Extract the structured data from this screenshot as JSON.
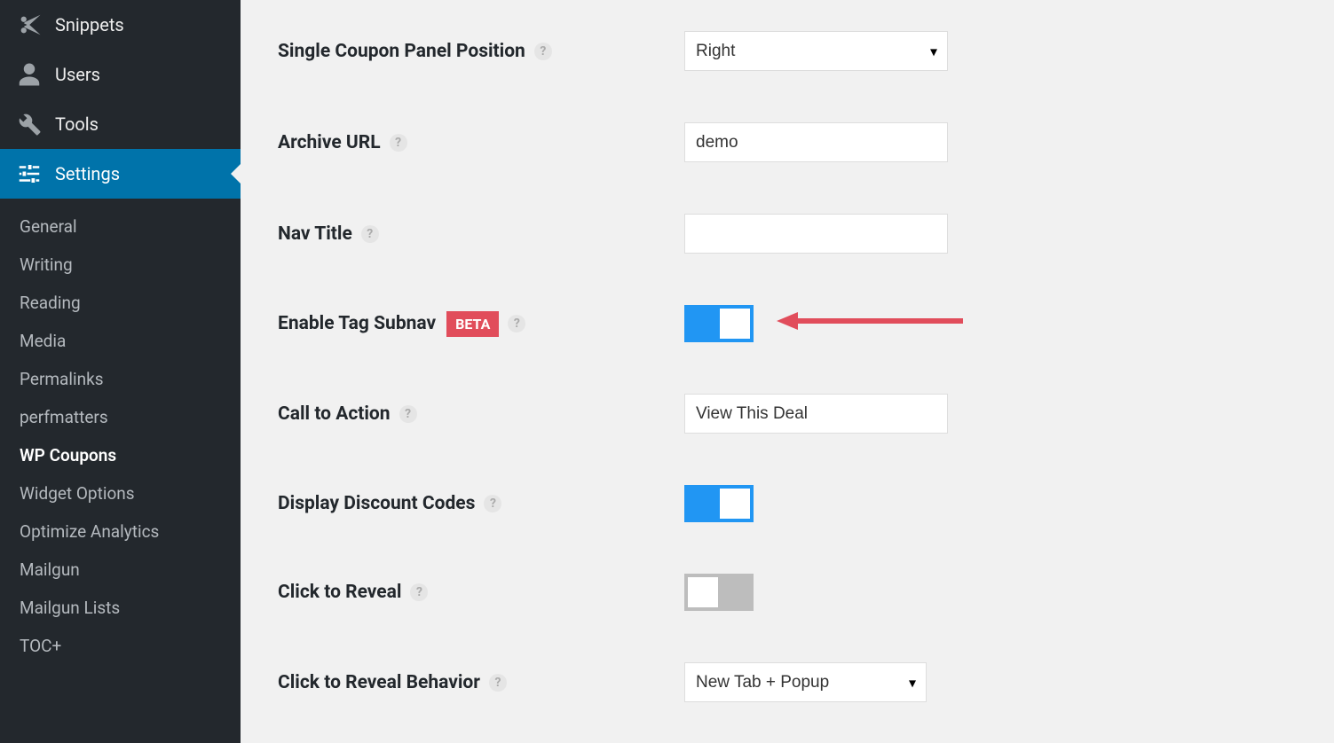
{
  "sidebar": {
    "nav": [
      {
        "label": "Snippets",
        "icon": "scissors"
      },
      {
        "label": "Users",
        "icon": "user"
      },
      {
        "label": "Tools",
        "icon": "wrench"
      },
      {
        "label": "Settings",
        "icon": "sliders",
        "active": true
      }
    ],
    "sub": [
      {
        "label": "General"
      },
      {
        "label": "Writing"
      },
      {
        "label": "Reading"
      },
      {
        "label": "Media"
      },
      {
        "label": "Permalinks"
      },
      {
        "label": "perfmatters"
      },
      {
        "label": "WP Coupons",
        "current": true
      },
      {
        "label": "Widget Options"
      },
      {
        "label": "Optimize Analytics"
      },
      {
        "label": "Mailgun"
      },
      {
        "label": "Mailgun Lists"
      },
      {
        "label": "TOC+"
      }
    ]
  },
  "form": {
    "coupon_panel_position": {
      "label": "Single Coupon Panel Position",
      "value": "Right"
    },
    "archive_url": {
      "label": "Archive URL",
      "value": "demo"
    },
    "nav_title": {
      "label": "Nav Title",
      "value": ""
    },
    "enable_tag_subnav": {
      "label": "Enable Tag Subnav",
      "badge": "BETA",
      "on": true
    },
    "call_to_action": {
      "label": "Call to Action",
      "value": "View This Deal"
    },
    "display_discount_codes": {
      "label": "Display Discount Codes",
      "on": true
    },
    "click_to_reveal": {
      "label": "Click to Reveal",
      "on": false
    },
    "click_to_reveal_behavior": {
      "label": "Click to Reveal Behavior",
      "value": "New Tab + Popup"
    }
  }
}
